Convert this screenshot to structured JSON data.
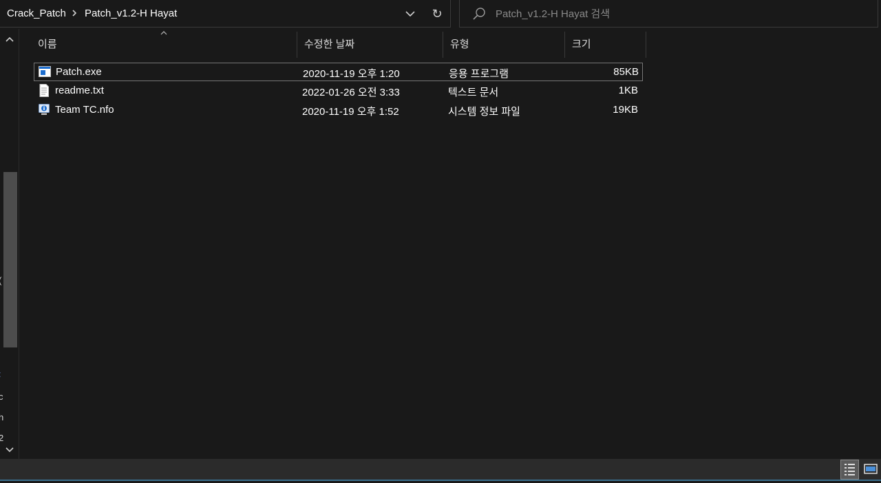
{
  "address": {
    "crumbs": [
      "Crack_Patch",
      "Patch_v1.2-H Hayat"
    ],
    "separator_icon": "chevron-right-icon",
    "dropdown_icon": "chevron-down-icon",
    "refresh_icon": "refresh-icon",
    "refresh_glyph": "↻"
  },
  "search": {
    "placeholder": "Patch_v1.2-H Hayat 검색",
    "icon": "search-icon"
  },
  "navpane": {
    "fragments": [
      "(",
      ":",
      "c",
      "h",
      "2"
    ]
  },
  "columns": {
    "name": "이름",
    "date": "수정한 날짜",
    "type": "유형",
    "size": "크기"
  },
  "files": [
    {
      "name": "Patch.exe",
      "date": "2020-11-19 오후 1:20",
      "type": "응용 프로그램",
      "size": "85KB",
      "icon": "application-icon",
      "selected": true
    },
    {
      "name": "readme.txt",
      "date": "2022-01-26 오전 3:33",
      "type": "텍스트 문서",
      "size": "1KB",
      "icon": "text-document-icon",
      "selected": false
    },
    {
      "name": "Team TC.nfo",
      "date": "2020-11-19 오후 1:52",
      "type": "시스템 정보 파일",
      "size": "19KB",
      "icon": "system-info-icon",
      "selected": false
    }
  ],
  "colors": {
    "background": "#191919",
    "statusbar": "#2b2b2b",
    "accent": "#3a6f8e",
    "app_icon_blue": "#1e6fd0"
  }
}
